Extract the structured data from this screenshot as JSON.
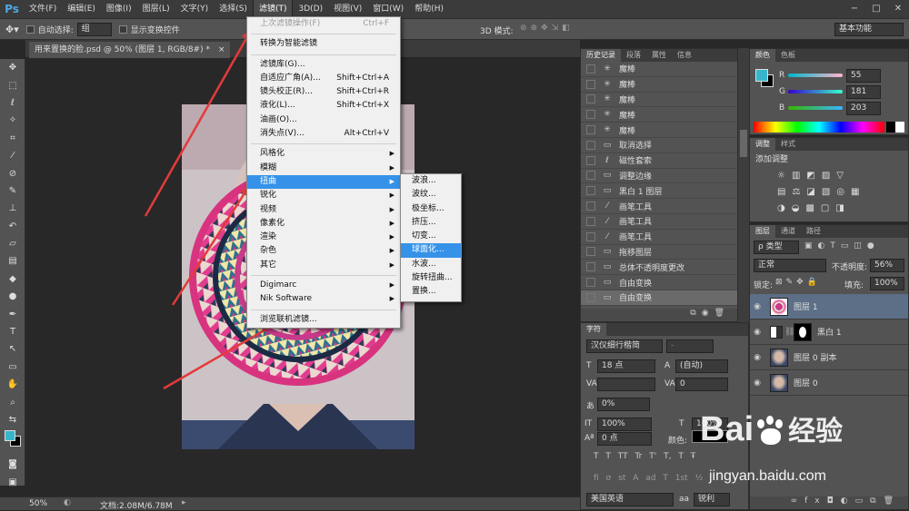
{
  "menubar": {
    "logo": "Ps",
    "items": [
      "文件(F)",
      "编辑(E)",
      "图像(I)",
      "图层(L)",
      "文字(Y)",
      "选择(S)",
      "滤镜(T)",
      "3D(D)",
      "视图(V)",
      "窗口(W)",
      "帮助(H)"
    ],
    "active_index": 6
  },
  "window_controls": {
    "min": "−",
    "max": "□",
    "close": "✕"
  },
  "options": {
    "auto_select_label": "自动选择:",
    "auto_select_value": "组",
    "show_transform_label": "显示变换控件",
    "mode_3d_label": "3D 模式:",
    "workspace": "基本功能"
  },
  "document": {
    "tab_title": "用来置换的脸.psd @ 50% (图层 1, RGB/8#) *",
    "tab_close": "×",
    "zoom": "50%",
    "doc_info": "文档:2.08M/6.78M"
  },
  "filter_menu": {
    "items": [
      {
        "label": "上次滤镜操作(F)",
        "shortcut": "Ctrl+F",
        "disabled": true
      },
      {
        "sep": true
      },
      {
        "label": "转换为智能滤镜"
      },
      {
        "sep": true
      },
      {
        "label": "滤镜库(G)..."
      },
      {
        "label": "自适应广角(A)...",
        "shortcut": "Shift+Ctrl+A"
      },
      {
        "label": "镜头校正(R)...",
        "shortcut": "Shift+Ctrl+R"
      },
      {
        "label": "液化(L)...",
        "shortcut": "Shift+Ctrl+X"
      },
      {
        "label": "油画(O)..."
      },
      {
        "label": "消失点(V)...",
        "shortcut": "Alt+Ctrl+V"
      },
      {
        "sep": true
      },
      {
        "label": "风格化",
        "submenu": true
      },
      {
        "label": "模糊",
        "submenu": true
      },
      {
        "label": "扭曲",
        "submenu": true,
        "highlighted": true
      },
      {
        "label": "锐化",
        "submenu": true
      },
      {
        "label": "视频",
        "submenu": true
      },
      {
        "label": "像素化",
        "submenu": true
      },
      {
        "label": "渲染",
        "submenu": true
      },
      {
        "label": "杂色",
        "submenu": true
      },
      {
        "label": "其它",
        "submenu": true
      },
      {
        "sep": true
      },
      {
        "label": "Digimarc",
        "submenu": true
      },
      {
        "label": "Nik Software",
        "submenu": true
      },
      {
        "sep": true
      },
      {
        "label": "浏览联机滤镜..."
      }
    ]
  },
  "distort_submenu": {
    "items": [
      {
        "label": "波浪..."
      },
      {
        "label": "波纹..."
      },
      {
        "label": "极坐标..."
      },
      {
        "label": "挤压..."
      },
      {
        "label": "切变..."
      },
      {
        "label": "球面化...",
        "highlighted": true
      },
      {
        "label": "水波..."
      },
      {
        "label": "旋转扭曲..."
      },
      {
        "label": "置换..."
      }
    ]
  },
  "history_panel": {
    "tabs": [
      "历史记录",
      "段落",
      "属性",
      "信息"
    ],
    "items": [
      {
        "icon": "magic-wand-icon",
        "label": "魔棒"
      },
      {
        "icon": "magic-wand-icon",
        "label": "魔棒"
      },
      {
        "icon": "magic-wand-icon",
        "label": "魔棒"
      },
      {
        "icon": "magic-wand-icon",
        "label": "魔棒"
      },
      {
        "icon": "magic-wand-icon",
        "label": "魔棒"
      },
      {
        "icon": "step-icon",
        "label": "取消选择"
      },
      {
        "icon": "lasso-icon",
        "label": "磁性套索"
      },
      {
        "icon": "step-icon",
        "label": "调整边缘"
      },
      {
        "icon": "step-icon",
        "label": "黑白 1 图层"
      },
      {
        "icon": "brush-icon",
        "label": "画笔工具"
      },
      {
        "icon": "brush-icon",
        "label": "画笔工具"
      },
      {
        "icon": "brush-icon",
        "label": "画笔工具"
      },
      {
        "icon": "step-icon",
        "label": "拖移图层"
      },
      {
        "icon": "step-icon",
        "label": "总体不透明度更改"
      },
      {
        "icon": "step-icon",
        "label": "自由变换"
      },
      {
        "icon": "step-icon",
        "label": "自由变换"
      }
    ],
    "selected_index": 15
  },
  "color_panel": {
    "tabs": [
      "颜色",
      "色板"
    ],
    "r_label": "R",
    "g_label": "G",
    "b_label": "B",
    "r": "55",
    "g": "181",
    "b": "203",
    "fg_color": "#37b5cb"
  },
  "adjustments_panel": {
    "tabs": [
      "调整",
      "样式"
    ],
    "title": "添加调整"
  },
  "character_panel": {
    "tab": "字符",
    "font": "汉仪细行楷简",
    "style": "-",
    "size": "18 点",
    "leading": "(自动)",
    "kerning": "",
    "tracking": "0",
    "scale_pct": "0%",
    "vscale": "100%",
    "hscale": "100%",
    "baseline": "0 点",
    "color_label": "颜色:",
    "language": "美国英语",
    "aa_label": "aa",
    "aa": "锐利",
    "style_buttons": [
      "T",
      "T",
      "TT",
      "Tr",
      "T'",
      "T,",
      "T",
      "Ŧ"
    ],
    "ot_buttons": [
      "fi",
      "σ",
      "st",
      "A",
      "ad",
      "T",
      "1st",
      "½"
    ]
  },
  "layers_panel": {
    "tabs": [
      "图层",
      "通道",
      "路径"
    ],
    "filter": "ρ 类型",
    "blend_mode": "正常",
    "opacity_label": "不透明度:",
    "opacity": "56%",
    "lock_label": "锁定:",
    "fill_label": "填充:",
    "fill": "100%",
    "layers": [
      {
        "name": "图层 1",
        "selected": true
      },
      {
        "name": "黑白 1",
        "adjustment": true
      },
      {
        "name": "图层 0 副本"
      },
      {
        "name": "图层 0"
      }
    ]
  },
  "watermark": {
    "brand": "Bai",
    "brand2": "经验",
    "url": "jingyan.baidu.com"
  }
}
